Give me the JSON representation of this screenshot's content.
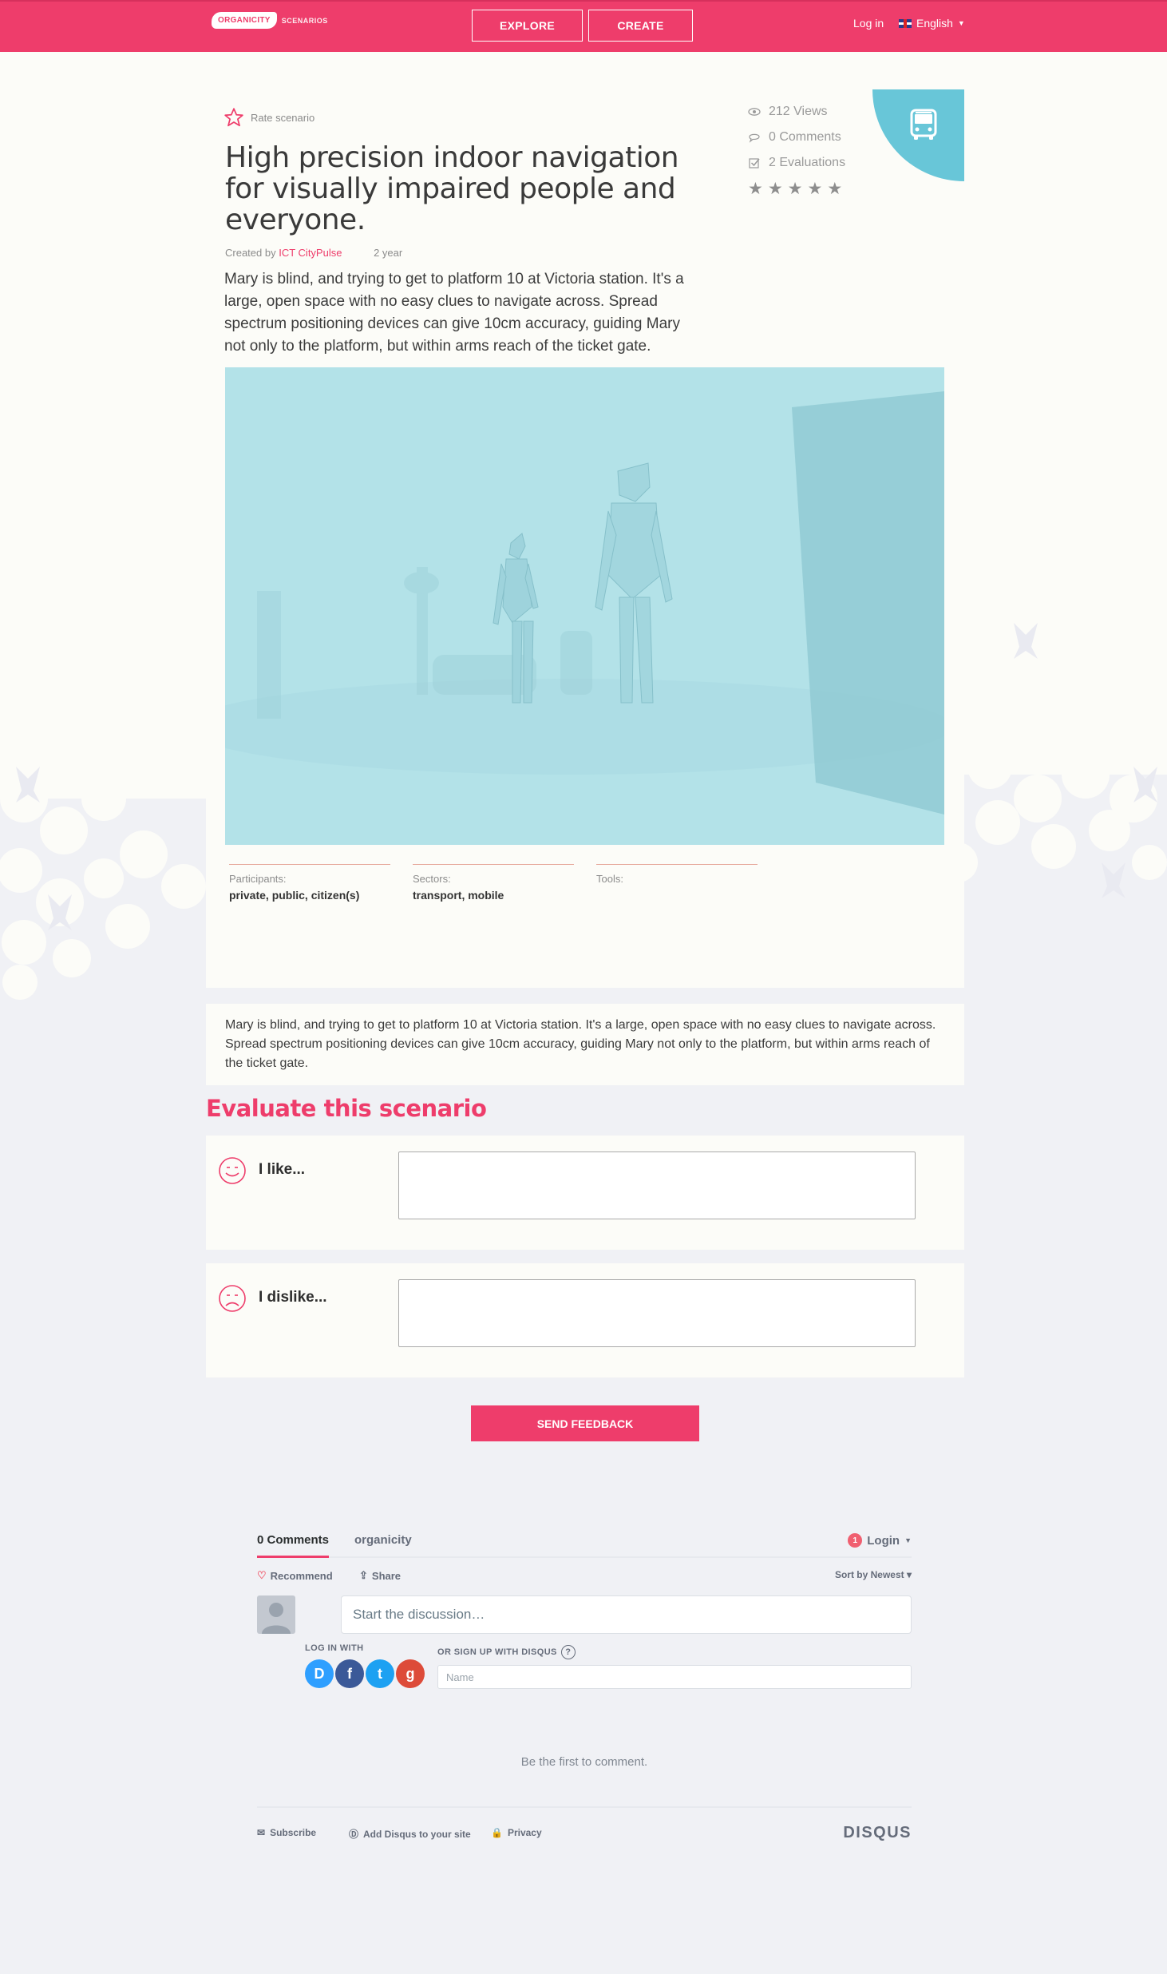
{
  "header": {
    "logo_text": "ORGANICITY",
    "logo_sub": "SCENARIOS",
    "nav": {
      "explore": "EXPLORE",
      "create": "CREATE"
    },
    "login": "Log in",
    "language": "English"
  },
  "scenario": {
    "rate_label": "Rate scenario",
    "title": "High precision indoor navigation for visually impaired people and everyone.",
    "created_by_label": "Created by",
    "author": "ICT CityPulse",
    "age": "2 year",
    "summary": "Mary is blind, and trying to get to platform 10 at Victoria station. It's a large, open space with no easy clues to navigate across. Spread spectrum positioning devices can give 10cm accuracy, guiding Mary not only to the platform, but within arms reach of the ticket gate.",
    "stats": {
      "views": "212 Views",
      "comments": "0 Comments",
      "evaluations": "2 Evaluations"
    },
    "rating_stars": 5,
    "category_icon": "bus-icon",
    "category_color": "#68c6d8",
    "fields": [
      {
        "label": "Participants:",
        "value": "private, public, citizen(s)"
      },
      {
        "label": "Sectors:",
        "value": "transport, mobile"
      },
      {
        "label": "Tools:",
        "value": ""
      }
    ],
    "description": "Mary is blind, and trying to get to platform 10 at Victoria station. It's a large, open space with no easy clues to navigate across. Spread spectrum positioning devices can give 10cm accuracy, guiding Mary not only to the platform, but within arms reach of the ticket gate."
  },
  "evaluate": {
    "title": "Evaluate this scenario",
    "like_label": "I like...",
    "dislike_label": "I dislike...",
    "send_label": "SEND FEEDBACK"
  },
  "disqus": {
    "tab_comments": "0 Comments",
    "tab_site": "organicity",
    "login": "Login",
    "login_badge": "1",
    "recommend": "Recommend",
    "share": "Share",
    "sort": "Sort by Newest",
    "input_placeholder": "Start the discussion…",
    "log_in_with": "LOG IN WITH",
    "sign_up": "OR SIGN UP WITH DISQUS",
    "name_placeholder": "Name",
    "empty": "Be the first to comment.",
    "footer": {
      "subscribe": "Subscribe",
      "add": "Add Disqus to your site",
      "privacy": "Privacy",
      "brand": "DISQUS"
    }
  },
  "colors": {
    "brand": "#ee3d6b",
    "accent": "#68c6d8",
    "background": "#f0f1f5"
  }
}
